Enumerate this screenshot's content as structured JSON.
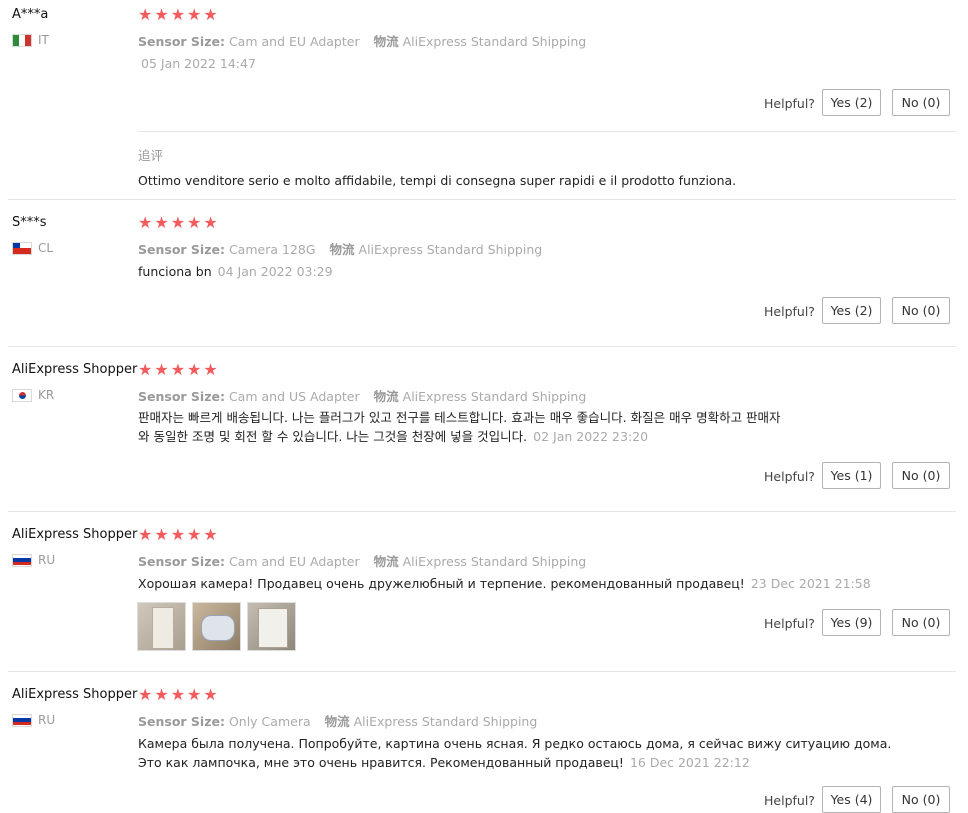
{
  "labels": {
    "sensor_size": "Sensor Size:",
    "shipping_key": "物流",
    "helpful": "Helpful?",
    "followup": "追评"
  },
  "colors": {
    "star": "#f25c5c",
    "muted": "#aaaaaa"
  },
  "reviews": [
    {
      "name": "A***a",
      "country": "IT",
      "stars": "★★★★★",
      "sensor": "Cam and EU Adapter",
      "shipping": "AliExpress Standard Shipping",
      "text": "",
      "date": "05 Jan 2022 14:47",
      "yes": "Yes (2)",
      "no": "No (0)",
      "followup": "Ottimo venditore serio e molto affidabile, tempi di consegna super rapidi e il prodotto funziona."
    },
    {
      "name": "S***s",
      "country": "CL",
      "stars": "★★★★★",
      "sensor": "Camera 128G",
      "shipping": "AliExpress Standard Shipping",
      "text": "funciona bn",
      "date": "04 Jan 2022 03:29",
      "yes": "Yes (2)",
      "no": "No (0)"
    },
    {
      "name": "AliExpress Shopper",
      "country": "KR",
      "stars": "★★★★★",
      "sensor": "Cam and US Adapter",
      "shipping": "AliExpress Standard Shipping",
      "text_line1": "판매자는 빠르게 배송됩니다. 나는 플러그가 있고 전구를 테스트합니다. 효과는 매우 좋습니다. 화질은 매우 명확하고 판매자",
      "text_line2": "와 동일한 조명 및 회전 할 수 있습니다. 나는 그것을 천장에 넣을 것입니다.",
      "date": "02 Jan 2022 23:20",
      "yes": "Yes (1)",
      "no": "No (0)"
    },
    {
      "name": "AliExpress Shopper",
      "country": "RU",
      "stars": "★★★★★",
      "sensor": "Cam and EU Adapter",
      "shipping": "AliExpress Standard Shipping",
      "text": "Хорошая камера! Продавец очень дружелюбный и терпение. рекомендованный продавец!",
      "date": "23 Dec 2021 21:58",
      "yes": "Yes (9)",
      "no": "No (0)"
    },
    {
      "name": "AliExpress Shopper",
      "country": "RU",
      "stars": "★★★★★",
      "sensor": "Only Camera",
      "shipping": "AliExpress Standard Shipping",
      "text_line1": "Камера была получена. Попробуйте, картина очень ясная. Я редко остаюсь дома, я сейчас вижу ситуацию дома.",
      "text_line2": "Это как лампочка, мне это очень нравится. Рекомендованный продавец!",
      "date": "16 Dec 2021 22:12",
      "yes": "Yes (4)",
      "no": "No (0)"
    }
  ]
}
